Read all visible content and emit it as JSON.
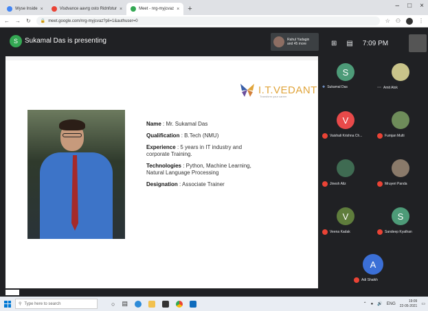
{
  "browser": {
    "tabs": [
      {
        "label": "Wyse Inside",
        "color": "#4285f4",
        "active": false
      },
      {
        "label": "Visdvance aavrg osto Ridnfotur",
        "color": "#ea4335",
        "active": false
      },
      {
        "label": "Meet - nrg-myjcvaz",
        "color": "#34a853",
        "active": true
      }
    ],
    "close_glyph": "×",
    "new_tab_glyph": "+",
    "window_controls": [
      "–",
      "□",
      "×"
    ],
    "url": "meet.google.com/nrg-myjcvaz?pli=1&authuser=0"
  },
  "meet": {
    "presenter_initial": "S",
    "presenting_text": "Sukamal Das is presenting",
    "mini_tile_label_line1": "Rahul Yadagin",
    "mini_tile_label_line2": "and 45 more",
    "time": "7:09 PM",
    "colors": {
      "dark": "#202124",
      "tile": "#3c4043",
      "mute": "#ea4335"
    }
  },
  "slide": {
    "brand": "I.T.VEDANT",
    "tagline": "Transform your career",
    "fields": [
      {
        "key": "Name",
        "value": ": Mr. Sukamal Das"
      },
      {
        "key": "Qualification",
        "value": ": B.Tech (NMU)"
      },
      {
        "key": "Experience",
        "value": ": 5 years in IT industry and corporate Training."
      },
      {
        "key": "Technologies",
        "value": ": Python, Machine Learning, Natural Language Processing"
      },
      {
        "key": "Designation",
        "value": ": Associate Trainer"
      }
    ]
  },
  "participants": [
    {
      "name": "Sukamal Das",
      "initial": "S",
      "color": "#4d9b78",
      "state": "presenting"
    },
    {
      "name": "Amit Alok",
      "initial": "",
      "color": "#c9c48a",
      "state": "more"
    },
    {
      "name": "Vaishali Krishna Ch...",
      "initial": "V",
      "color": "#e84a4a",
      "state": "muted"
    },
    {
      "name": "Fumjan Multi",
      "initial": "",
      "color": "#6e8c5a",
      "state": "muted"
    },
    {
      "name": "Jinesh Aliz",
      "initial": "",
      "color": "#3f6b52",
      "state": "muted"
    },
    {
      "name": "Mruyeri Panda",
      "initial": "",
      "color": "#8a7a6a",
      "state": "muted"
    },
    {
      "name": "Veena Kadak",
      "initial": "V",
      "color": "#5f7d3c",
      "state": "muted"
    },
    {
      "name": "Sandeep Kyathan",
      "initial": "S",
      "color": "#4d9b78",
      "state": "muted"
    },
    {
      "name": "Adi Shaikh",
      "initial": "A",
      "color": "#3b6fd6",
      "state": "muted"
    }
  ],
  "taskbar": {
    "search_placeholder": "Type here to search",
    "clock_time": "19:09",
    "clock_date": "22-05-2021",
    "tray_lang": "ENG"
  }
}
